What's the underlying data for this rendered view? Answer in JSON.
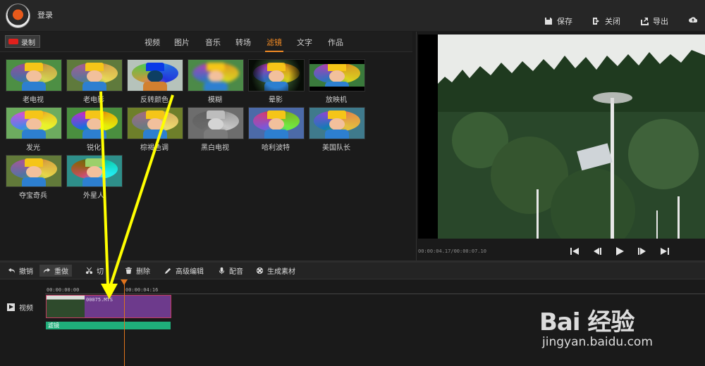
{
  "header": {
    "login": "登录",
    "buttons": [
      {
        "label": "保存",
        "icon": "save-icon"
      },
      {
        "label": "关闭",
        "icon": "exit-icon"
      },
      {
        "label": "导出",
        "icon": "export-icon"
      },
      {
        "label": "",
        "icon": "cloud-upload-icon"
      }
    ]
  },
  "record": {
    "label": "录制"
  },
  "tabs": [
    {
      "label": "视频"
    },
    {
      "label": "图片"
    },
    {
      "label": "音乐"
    },
    {
      "label": "转场"
    },
    {
      "label": "滤镜",
      "active": true
    },
    {
      "label": "文字"
    },
    {
      "label": "作品"
    }
  ],
  "filters": [
    {
      "label": "老电视"
    },
    {
      "label": "老电影"
    },
    {
      "label": "反转颜色"
    },
    {
      "label": "模糊"
    },
    {
      "label": "晕影"
    },
    {
      "label": "放映机"
    },
    {
      "label": "发光"
    },
    {
      "label": "锐化"
    },
    {
      "label": "棕褐色调"
    },
    {
      "label": "黑白电视"
    },
    {
      "label": "哈利波特"
    },
    {
      "label": "美国队长"
    },
    {
      "label": "夺宝奇兵"
    },
    {
      "label": "外星人"
    }
  ],
  "preview": {
    "timecode": "00:00:04.17/00:00:07.10"
  },
  "toolbar": {
    "undo": "撤销",
    "redo": "重做",
    "cut": "切",
    "delete": "删除",
    "advanced": "高级编辑",
    "dub": "配音",
    "generate": "生成素材"
  },
  "timeline": {
    "track_label": "视频",
    "ticks": [
      "00:00:00:00",
      "00:00:04:16"
    ],
    "clip_name": "00075.MTS",
    "filter_bar": "滤镜"
  },
  "watermark": {
    "title": "Bai 经验",
    "sub": "jingyan.baidu.com"
  },
  "colors": {
    "accent": "#f08a24",
    "filter_bar": "#1fae7a",
    "clip": "#6d3a8c",
    "annotation_arrow": "#ffff00"
  }
}
